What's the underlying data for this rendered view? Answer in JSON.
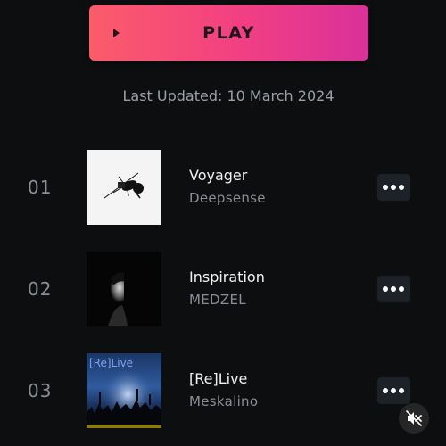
{
  "play_button": {
    "label": "PLAY",
    "icon": "play-icon"
  },
  "last_updated": "Last Updated: 10 March 2024",
  "tracks": [
    {
      "number": "01",
      "title": "Voyager",
      "artist": "Deepsense",
      "cover": "voyager-cover"
    },
    {
      "number": "02",
      "title": "Inspiration",
      "artist": "MEDZEL",
      "cover": "inspiration-cover"
    },
    {
      "number": "03",
      "title": "[Re]Live",
      "artist": "Meskalino",
      "cover": "relive-cover",
      "cover_text": "[Re]Live"
    }
  ],
  "more_button": {
    "icon": "more-horizontal-icon"
  },
  "mute_button": {
    "icon": "volume-muted-icon"
  },
  "colors": {
    "background": "#0d0e10",
    "play_gradient_start": "#fb5c6a",
    "play_gradient_end": "#d9319a",
    "muted_text": "#8a8f96"
  }
}
